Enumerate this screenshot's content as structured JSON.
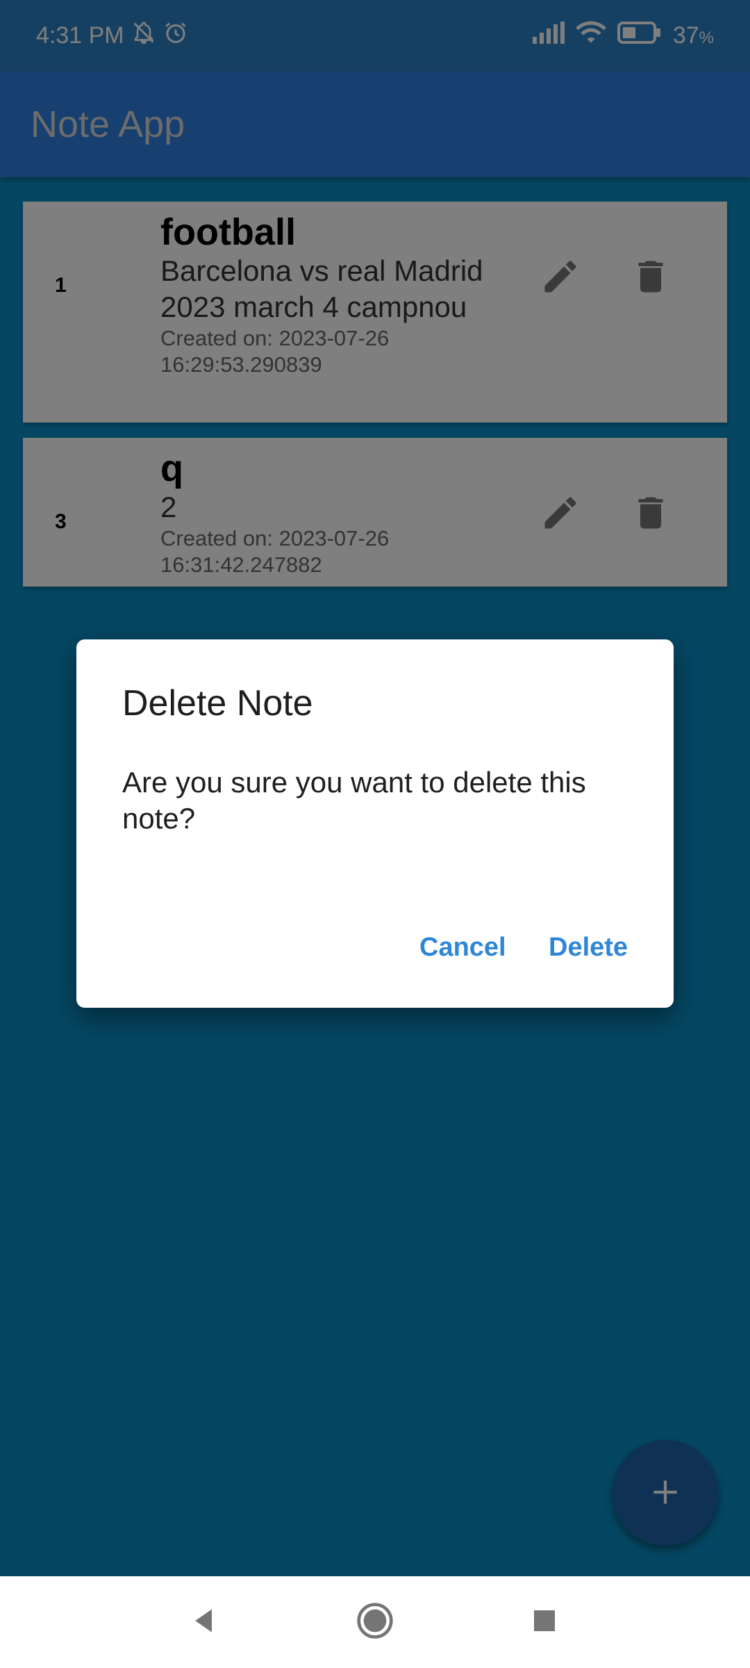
{
  "status": {
    "time": "4:31 PM",
    "battery": "37",
    "battery_unit": "%"
  },
  "app": {
    "title": "Note App"
  },
  "notes": [
    {
      "id": "1",
      "title": "football",
      "content": "Barcelona vs real Madrid 2023 march 4 campnou",
      "created": "Created on: 2023-07-26 16:29:53.290839"
    },
    {
      "id": "3",
      "title": "q",
      "content": "2",
      "created": "Created on: 2023-07-26 16:31:42.247882"
    }
  ],
  "dialog": {
    "title": "Delete Note",
    "message": "Are you sure you want to delete this note?",
    "cancel_label": "Cancel",
    "delete_label": "Delete"
  },
  "fab": {
    "label": "+"
  },
  "colors": {
    "app_bar": "#2f80e0",
    "background": "#0a8fc6",
    "accent": "#2e86d6"
  }
}
